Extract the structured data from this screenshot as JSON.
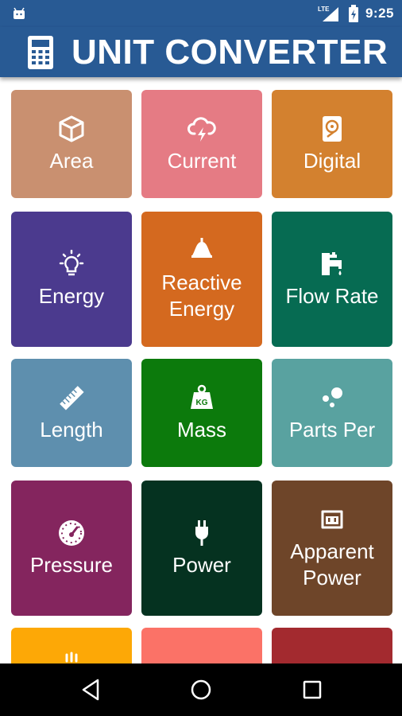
{
  "status_bar": {
    "network": "LTE",
    "time": "9:25"
  },
  "app_bar": {
    "title": "UNIT CONVERTER",
    "icon": "calculator-icon"
  },
  "tiles": [
    {
      "label": "Area",
      "icon": "cube-icon",
      "color": "#C99070"
    },
    {
      "label": "Current",
      "icon": "cloud-bolt-icon",
      "color": "#E57B84"
    },
    {
      "label": "Digital",
      "icon": "hard-drive-icon",
      "color": "#D3812F"
    },
    {
      "label": "Energy",
      "icon": "lightbulb-icon",
      "color": "#4B3A8E"
    },
    {
      "label": "Reactive Energy",
      "lines": [
        "Reactive",
        "Energy"
      ],
      "icon": "bell-lamp-icon",
      "color": "#D4691F"
    },
    {
      "label": "Flow Rate",
      "icon": "water-tap-icon",
      "color": "#066B52"
    },
    {
      "label": "Length",
      "icon": "ruler-icon",
      "color": "#5E8FAE"
    },
    {
      "label": "Mass",
      "icon": "kg-weight-icon",
      "color": "#0C7A0C"
    },
    {
      "label": "Parts Per",
      "icon": "bubbles-icon",
      "color": "#59A2A0"
    },
    {
      "label": "Pressure",
      "icon": "gauge-icon",
      "color": "#84255E"
    },
    {
      "label": "Power",
      "icon": "plug-icon",
      "color": "#053220"
    },
    {
      "label": "Apparent Power",
      "lines": [
        "Apparent",
        "Power"
      ],
      "icon": "power-outlet-icon",
      "color": "#6E4529"
    },
    {
      "label": "",
      "icon": "partial-icon",
      "color": "#FDA806"
    },
    {
      "label": "",
      "icon": "",
      "color": "#FB7267"
    },
    {
      "label": "",
      "icon": "",
      "color": "#A32A2F"
    }
  ],
  "nav_bar": {
    "back": "back-icon",
    "home": "home-icon",
    "recents": "recents-icon"
  }
}
